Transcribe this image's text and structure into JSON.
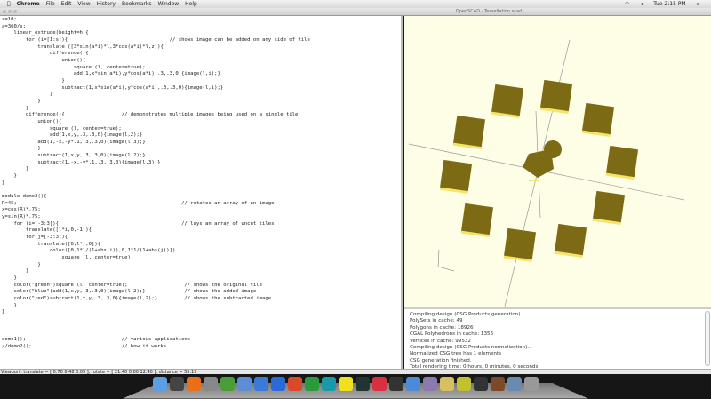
{
  "menubar": {
    "apple": "",
    "app": "Chrome",
    "items": [
      "File",
      "Edit",
      "View",
      "History",
      "Bookmarks",
      "Window",
      "Help"
    ],
    "clock": "Tue 2:15 PM"
  },
  "window": {
    "title": "OpenSCAD - Tessellation.scad"
  },
  "editor": {
    "code": "s=10;\na=360/s;\n    linear_extrude(height=h){\n        for (i=[1:s]){                                  // shows image can be added on any side of tile\n            translate ([3*sin(a*i)*l,3*cos(a*i)*l,z]){\n                difference(){\n                    union(){\n                        square (l, center=true);\n                        add(1,x*sin(a*i),y*cos(a*i),.3,.3,0){image(l,i);}\n                    }\n                    subtract(1,x*sin(a*i),y*cos(a*i),.3,.3,0){image(l,i);}\n                }\n            }\n        }\n        difference(){                   // demonstrates multiple images being used on a single tile\n            union(){\n                square (l, center=true);\n                add(1,x,y,.3,.3,0){image(l,2);}\n            add(1,-x,-y*.1,.3,.3,0){image(l,3);}\n            }\n            subtract(1,x,y,.3,.3,0){image(l,2);}\n            subtract(1,-x,-y*.1,.3,.3,0){image(l,3);}\n        }\n    }\n}\n\nmodule demo2(){\nR=45;                                                       // rotates an array of an image\nx=cos(R)*.75;\ny=sin(R)*.75;\n    for (i=[-3:3]){                                         // lays an array of uncut tiles\n        translate([l*i,0,-1]){\n        for(j=[-3:3]){\n            translate([0,l*j,0]){\n                color([0,1*1/(1+abs(i)),0,1*1/(1+abs(j))])\n                    square (l, center=true);\n            }\n        }\n    }\n    color(\"green\")square (l, center=true);                   // shows the original tile\n    color(\"blue\")add(1,x,y,.3,.3,0){image(l,2);}             // shows the added image\n    color(\"red\")subtract(1,x,y,.3,.3,0){image(l,2);}         // shows the subtracted image\n    }\n}\n\n\n\ndemo1();                                // various applications\n//demo2();                              // how it works"
  },
  "console": {
    "lines": [
      "Compiling design (CSG Products generation)...",
      "PolySets in cache: 49",
      "Polygons in cache: 18926",
      "CGAL Polyhedrons in cache: 1356",
      "Vertices in cache: 99532",
      "Compiling design (CSG Products normalization)...",
      "Normalized CSG tree has 1 elements",
      "CSG generation finished.",
      "Total rendering time: 0 hours, 0 minutes, 0 seconds"
    ]
  },
  "statusbar": {
    "text": "Viewport: translate = [ 0.70 0.48 0.09 ], rotate = [ 21.40 0.00 12.40 ], distance = 55.19"
  },
  "colors": {
    "tile": "#7d6a14",
    "tile_edge": "#f5e36a",
    "viewport_bg": "#fefee6"
  },
  "dock": {
    "icons": [
      "finder-icon",
      "dashboard-icon",
      "firefox-icon",
      "imovie-icon",
      "chrome-icon",
      "safari-icon",
      "itunes-icon",
      "word-icon",
      "powerpoint-icon",
      "excel-icon",
      "arduino-icon",
      "inkscape-icon",
      "p-app-icon",
      "flipboard-icon",
      "terminal-icon",
      "xcode-icon",
      "preview-icon",
      "coffee-icon",
      "yellow-app-icon",
      "openscad-icon",
      "gimp-icon",
      "mail-icon",
      "trash-icon"
    ]
  }
}
